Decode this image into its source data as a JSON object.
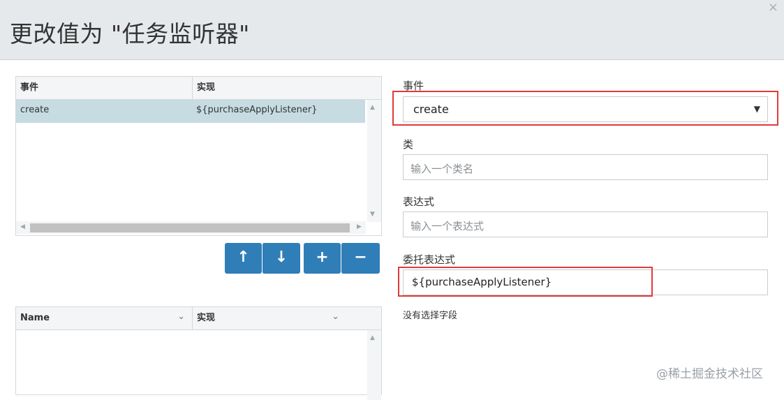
{
  "dialog": {
    "title": "更改值为 \"任务监听器\"",
    "close_glyph": "×"
  },
  "listeners_table": {
    "columns": [
      "事件",
      "实现"
    ],
    "rows": [
      {
        "event": "create",
        "implementation": "${purchaseApplyListener}"
      }
    ],
    "selected_row_color": "#c6dce2"
  },
  "toolbar": {
    "move_up": "↑",
    "move_down": "↓",
    "add": "+",
    "remove": "−",
    "button_color": "#2f7eb8"
  },
  "fields_table": {
    "columns": [
      "Name",
      "实现"
    ],
    "sort_icon": "⌄"
  },
  "form": {
    "event_label": "事件",
    "event_value": "create",
    "class_label": "类",
    "class_placeholder": "输入一个类名",
    "expression_label": "表达式",
    "expression_placeholder": "输入一个表达式",
    "delegate_label": "委托表达式",
    "delegate_value": "${purchaseApplyListener}",
    "no_field_text": "没有选择字段"
  },
  "highlight_color": "#e03a3a",
  "watermark": "@稀土掘金技术社区"
}
